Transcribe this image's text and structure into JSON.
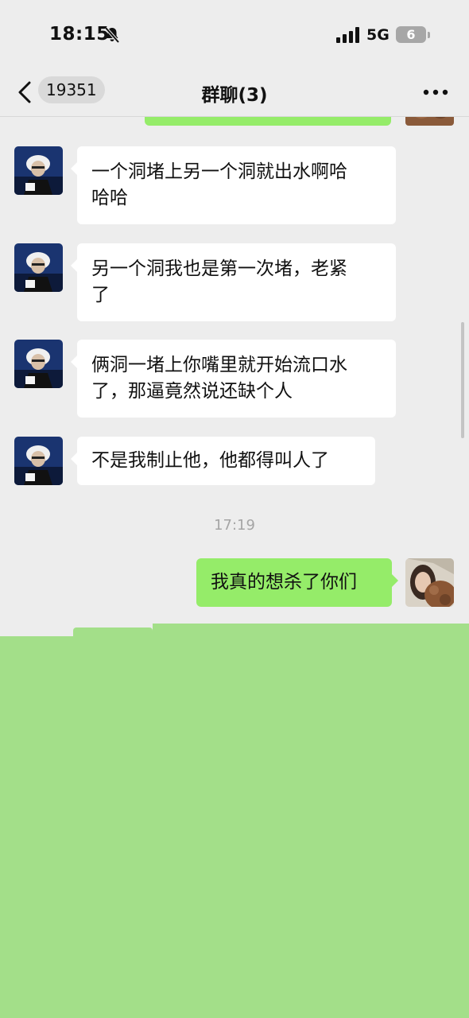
{
  "status_bar": {
    "time": "18:15",
    "network": "5G",
    "battery": "6",
    "icons": [
      "bell-muted-icon",
      "signal-icon",
      "battery-icon"
    ]
  },
  "nav": {
    "back_count": "19351",
    "title": "群聊(3)",
    "icons": [
      "back-chevron-icon",
      "more-icon"
    ]
  },
  "messages": [
    {
      "sender": "other",
      "text_line1": "一个洞堵上另一个洞就出水啊哈",
      "text_line2": "哈哈"
    },
    {
      "sender": "other",
      "text_line1": "另一个洞我也是第一次堵，老紧",
      "text_line2": "了"
    },
    {
      "sender": "other",
      "text_line1": "俩洞一堵上你嘴里就开始流口水",
      "text_line2": "了，那逼竟然说还缺个人"
    },
    {
      "sender": "other",
      "text_line1": "不是我制止他，他都得叫人了"
    }
  ],
  "timestamp": "17:19",
  "my_message": "我真的想杀了你们",
  "colors": {
    "background": "#ededed",
    "my_bubble": "#95ec69",
    "other_bubble": "#ffffff",
    "overlay": "#a3df89"
  }
}
